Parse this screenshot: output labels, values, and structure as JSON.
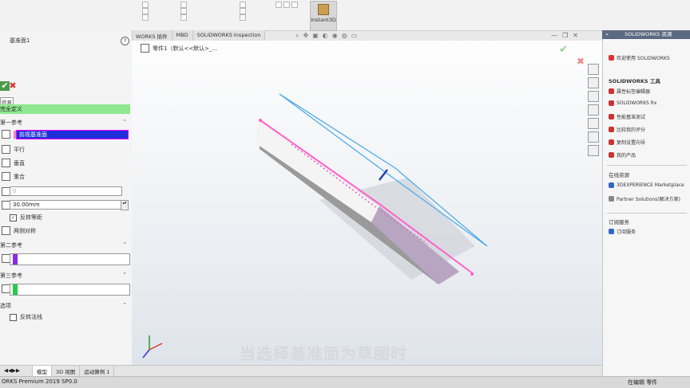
{
  "ribbon": {
    "groups": [
      {
        "lines": [
          "",
          "",
          ""
        ]
      },
      {
        "lines": [
          "",
          "",
          ""
        ]
      },
      {
        "lines": [
          "",
          "",
          ""
        ]
      }
    ],
    "instant3d_label": "Instant3D"
  },
  "command_tabs": [
    "WORKS 插件",
    "MBD",
    "SOLIDWORKS Inspection"
  ],
  "feature_tree_flyout": "零件1（默认<<默认>_...",
  "property_manager": {
    "title": "基准面1",
    "help": "?",
    "ok_label": "✔",
    "cancel_label": "✖",
    "message_tooltip": "信息",
    "message_text": "完全定义",
    "first_reference": {
      "header": "第一参考",
      "selection": "前视基准面",
      "options": [
        "平行",
        "垂直",
        "重合"
      ],
      "angle_value": "0",
      "distance_value": "30.00mm",
      "flip_offset_label": "反转等距",
      "mid_plane_label": "两侧对称"
    },
    "second_reference": {
      "header": "第二参考",
      "color": "#8a2be2"
    },
    "third_reference": {
      "header": "第三参考",
      "color": "#22cc44"
    },
    "options_section": {
      "header": "选项",
      "flip_normal_label": "反转法线"
    }
  },
  "graphics": {
    "subtitle": "当选择基准面为草图时",
    "ok_confirm": "✔",
    "cancel_confirm": "✖"
  },
  "bottom_tabs": [
    "模型",
    "3D 视图",
    "运动算例 1"
  ],
  "status": {
    "left": "ORKS Premium 2019 SP0.0",
    "right": "在编辑 零件"
  },
  "task_pane": {
    "header": "SOLIDWORKS 资源",
    "welcome": "欢迎使用 SOLIDWORKS",
    "tools_header": "SOLIDWORKS 工具",
    "tools": [
      "属性标签编辑器",
      "SOLIDWORKS Rx",
      "性能基准测试",
      "比较我的评分",
      "复制设置向导",
      "我的产品"
    ],
    "online_header": "在线资源",
    "online": [
      "3DEXPERIENCE Marketplace",
      "Partner Solutions(解决方案)"
    ],
    "subscription_header": "订阅服务",
    "subscription": [
      "订阅服务"
    ]
  }
}
